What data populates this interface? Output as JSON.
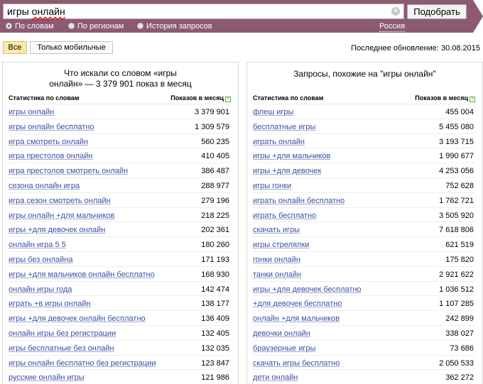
{
  "search": {
    "query_prefix": "игры ",
    "query_underlined": "онлайн",
    "submit_label": "Подобрать"
  },
  "modes": [
    {
      "label": "По словам",
      "selected": true
    },
    {
      "label": "По регионам",
      "selected": false
    },
    {
      "label": "История запросов",
      "selected": false
    }
  ],
  "region": "Россия",
  "filters": [
    {
      "label": "Все",
      "active": true
    },
    {
      "label": "Только мобильные",
      "active": false
    }
  ],
  "last_update": "Последнее обновление: 30.08.2015",
  "left_panel": {
    "title_line1": "Что искали со словом «игры",
    "title_line2": "онлайн» — 3 379 901 показ в месяц",
    "col_keyword": "Статистика по словам",
    "col_count": "Показов в месяц",
    "rows": [
      {
        "keyword": "игры онлайн",
        "count": "3 379 901"
      },
      {
        "keyword": "игры онлайн бесплатно",
        "count": "1 309 579"
      },
      {
        "keyword": "игра смотреть онлайн",
        "count": "560 235"
      },
      {
        "keyword": "игра престолов онлайн",
        "count": "410 405"
      },
      {
        "keyword": "игра престолов смотреть онлайн",
        "count": "386 487"
      },
      {
        "keyword": "сезона онлайн игра",
        "count": "288 977"
      },
      {
        "keyword": "игра сезон смотреть онлайн",
        "count": "279 196"
      },
      {
        "keyword": "игры онлайн +для мальчиков",
        "count": "218 225"
      },
      {
        "keyword": "игры +для девочек онлайн",
        "count": "202 361"
      },
      {
        "keyword": "онлайн игра 5 5",
        "count": "180 260"
      },
      {
        "keyword": "игры без онлайна",
        "count": "171 193"
      },
      {
        "keyword": "игры +для мальчиков онлайн бесплатно",
        "count": "168 930"
      },
      {
        "keyword": "онлайн игры года",
        "count": "142 474"
      },
      {
        "keyword": "играть +в игры онлайн",
        "count": "138 177"
      },
      {
        "keyword": "игры +для девочек онлайн бесплатно",
        "count": "136 409"
      },
      {
        "keyword": "онлайн игры без регистрации",
        "count": "132 405"
      },
      {
        "keyword": "игры бесплатные без онлайн",
        "count": "132 035"
      },
      {
        "keyword": "игры онлайн бесплатно без регистрации",
        "count": "123 847"
      },
      {
        "keyword": "русские онлайн игры",
        "count": "121 986"
      }
    ]
  },
  "right_panel": {
    "title": "Запросы, похожие на \"игры онлайн\"",
    "col_keyword": "Статистика по словам",
    "col_count": "Показов в месяц",
    "rows": [
      {
        "keyword": "флеш игры",
        "count": "455 004"
      },
      {
        "keyword": "бесплатные игры",
        "count": "5 455 080"
      },
      {
        "keyword": "играть онлайн",
        "count": "3 193 715"
      },
      {
        "keyword": "игры +для мальчиков",
        "count": "1 990 677"
      },
      {
        "keyword": "игры +для девочек",
        "count": "4 253 056"
      },
      {
        "keyword": "игры гонки",
        "count": "752 628"
      },
      {
        "keyword": "играть онлайн бесплатно",
        "count": "1 762 721"
      },
      {
        "keyword": "играть бесплатно",
        "count": "3 505 920"
      },
      {
        "keyword": "скачать игры",
        "count": "7 618 806"
      },
      {
        "keyword": "игры стрелялки",
        "count": "621 519"
      },
      {
        "keyword": "гонки онлайн",
        "count": "175 820"
      },
      {
        "keyword": "танки онлайн",
        "count": "2 921 622"
      },
      {
        "keyword": "игры +для девочек бесплатно",
        "count": "1 036 512"
      },
      {
        "keyword": "+для девочек бесплатно",
        "count": "1 107 285"
      },
      {
        "keyword": "онлайн +для мальчиков",
        "count": "242 899"
      },
      {
        "keyword": "девочки онлайн",
        "count": "338 027"
      },
      {
        "keyword": "браузерные игры",
        "count": "73 686"
      },
      {
        "keyword": "скачать игры бесплатно",
        "count": "2 050 533"
      },
      {
        "keyword": "дети онлайн",
        "count": "362 272"
      }
    ]
  }
}
